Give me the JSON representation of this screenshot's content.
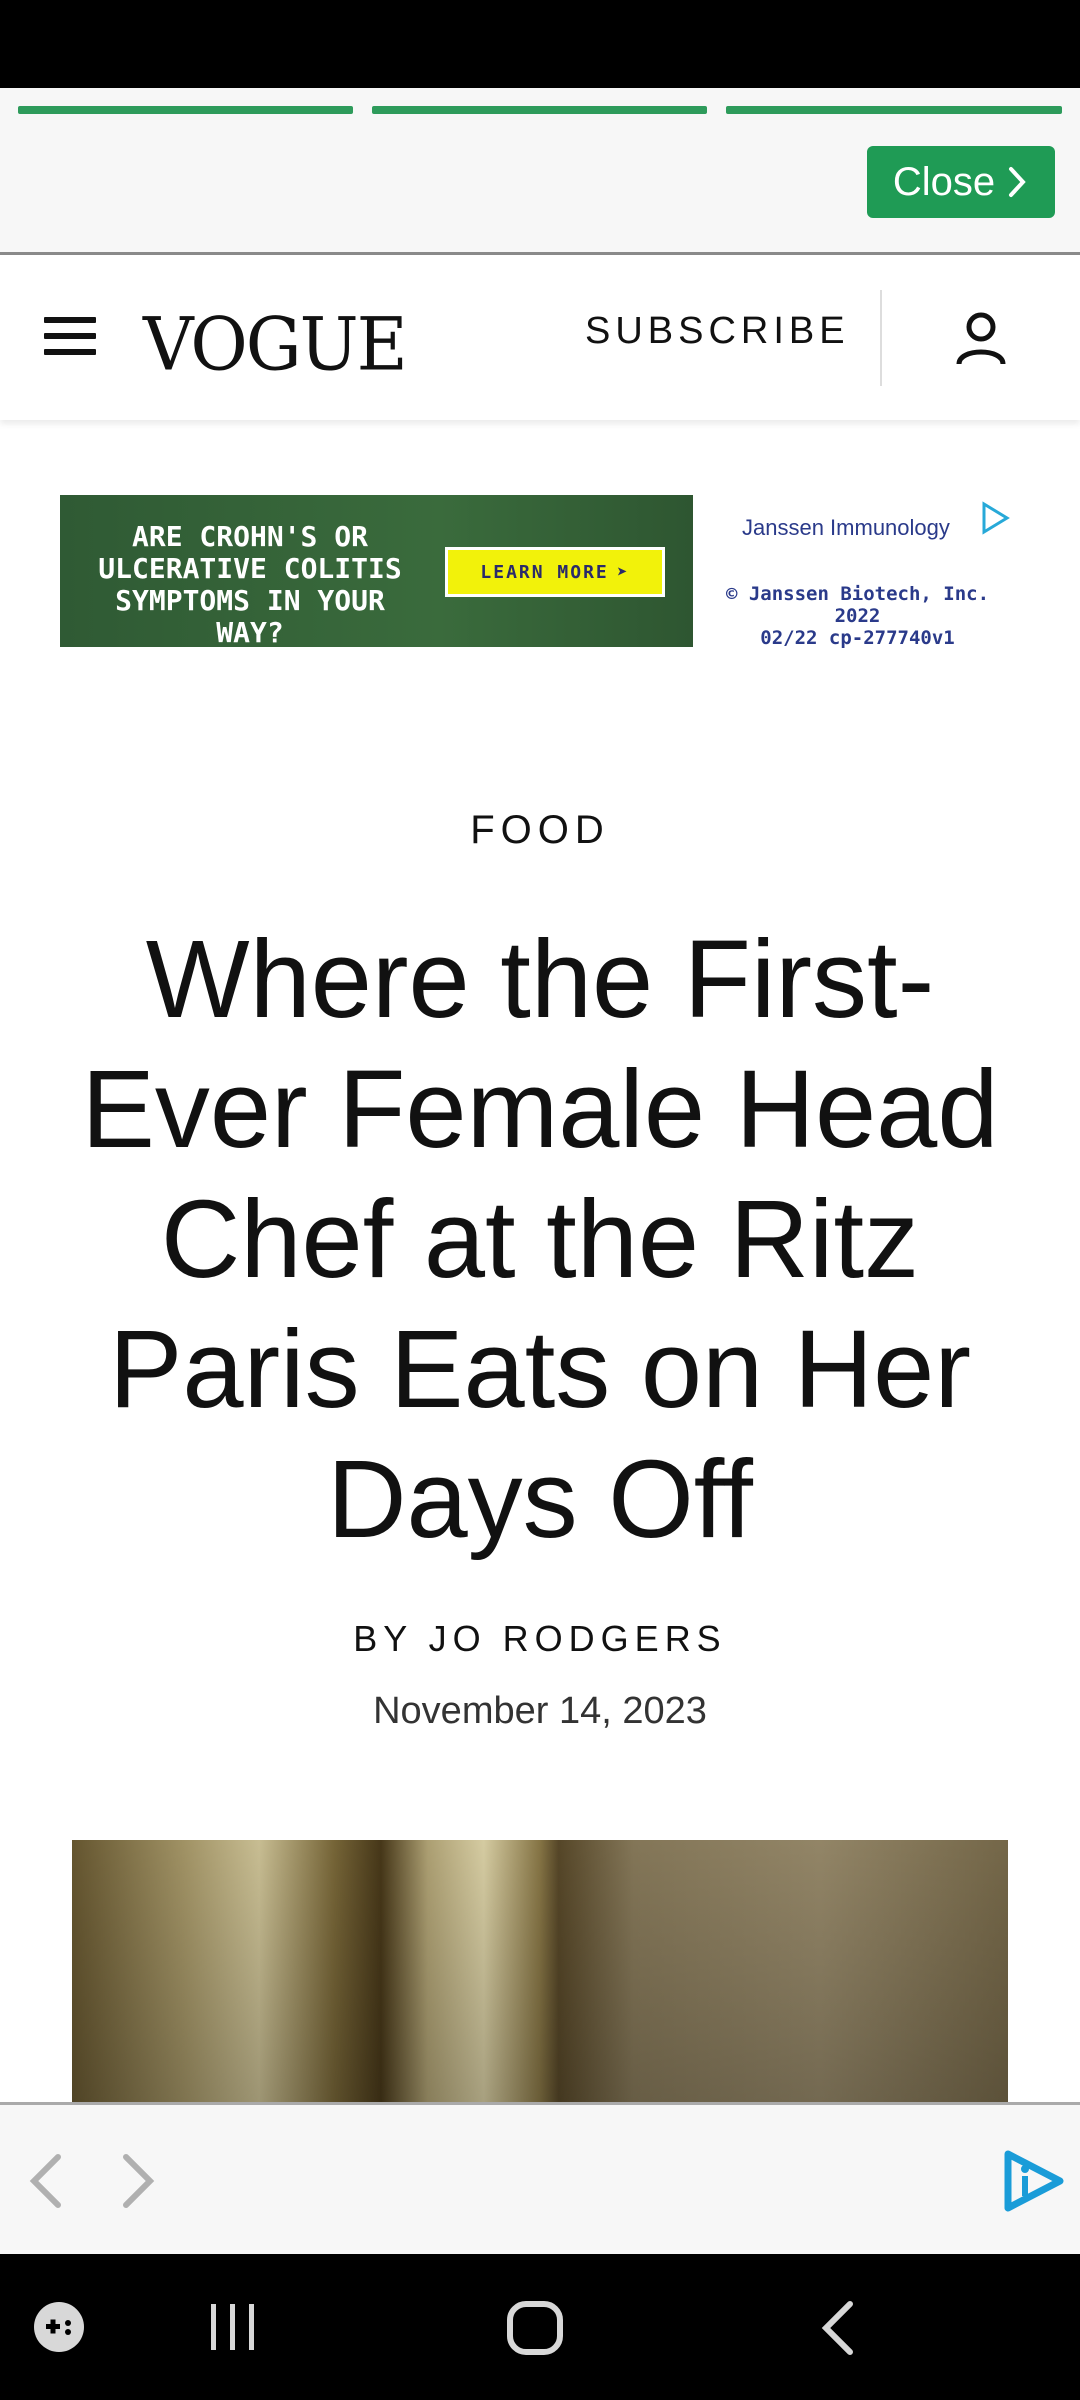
{
  "story_bar": {
    "segments": 3,
    "close_label": "Close"
  },
  "header": {
    "logo": "VOGUE",
    "subscribe_label": "SUBSCRIBE"
  },
  "ad": {
    "headline": "ARE CROHN'S OR ULCERATIVE COLITIS SYMPTOMS IN YOUR WAY?",
    "cta": "LEARN MORE",
    "brand": "Janssen Immunology",
    "legal_line1": "© Janssen Biotech, Inc. 2022",
    "legal_line2": "02/22 cp-277740v1"
  },
  "article": {
    "category": "FOOD",
    "headline": "Where the First-Ever Female Head Chef at the Ritz Paris Eats on Her Days Off",
    "byline": "BY JO RODGERS",
    "date": "November 14, 2023"
  },
  "colors": {
    "accent_green": "#1f9b55",
    "progress_green": "#2e9b5b",
    "adplayer_blue": "#1a9cd8"
  },
  "icons": {
    "menu": "hamburger-icon",
    "account": "person-icon",
    "prev": "chevron-left-icon",
    "next": "chevron-right-icon",
    "adplayer": "adplayer-logo-icon"
  }
}
